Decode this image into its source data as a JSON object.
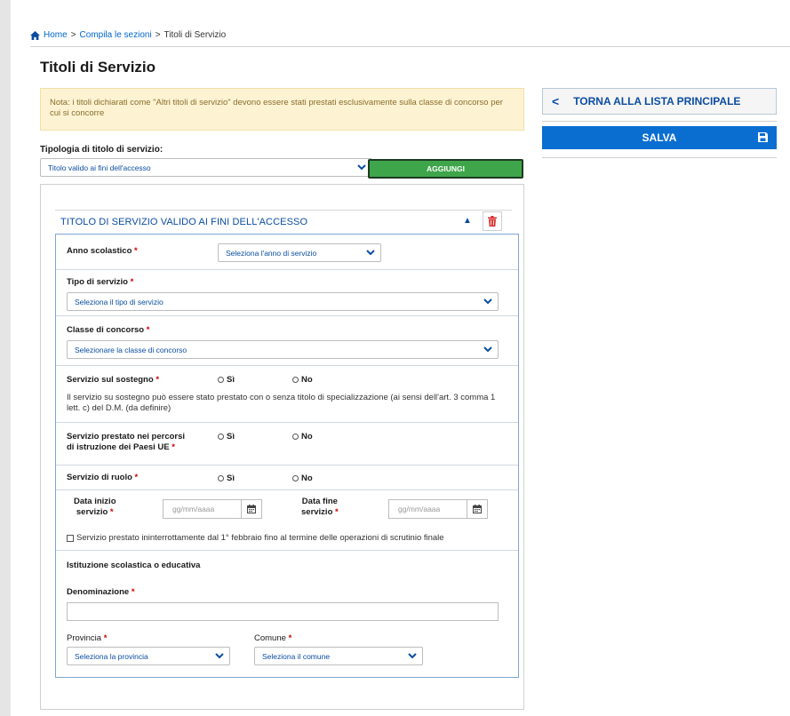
{
  "breadcrumb": {
    "home": "Home",
    "sep1": ">",
    "compila": "Compila le sezioni",
    "sep2": ">",
    "current": "Titoli di Servizio"
  },
  "page_title": "Titoli di Servizio",
  "note": "Nota: i titoli dichiarati come \"Altri titoli di servizio\" devono essere stati prestati esclusivamente sulla classe di concorso per cui si concorre",
  "tipologia": {
    "label": "Tipologia di titolo di servizio:",
    "selected": "Titolo valido ai fini dell'accesso",
    "add_label": "AGGIUNGI"
  },
  "side": {
    "back_chevron": "<",
    "back_label": "TORNA ALLA LISTA PRINCIPALE",
    "save_label": "SALVA"
  },
  "card": {
    "title": "TITOLO DI SERVIZIO VALIDO AI FINI DELL'ACCESSO",
    "collapse_glyph": "▲",
    "required_mark": "*",
    "anno": {
      "label": "Anno scolastico",
      "placeholder": "Seleziona l'anno di servizio"
    },
    "tipo": {
      "label": "Tipo di servizio",
      "placeholder": "Seleziona il tipo di servizio"
    },
    "classe": {
      "label": "Classe di concorso",
      "placeholder": "Selezionare la classe di concorso"
    },
    "sostegno": {
      "label": "Servizio sul sostegno",
      "yes": "Sì",
      "no": "No",
      "hint": "Il servizio su sostegno può essere stato prestato con o senza titolo di specializzazione (ai sensi dell'art. 3 comma 1 lett. c) del D.M. (da definire)"
    },
    "ue": {
      "label_line1": "Servizio prestato nei percorsi",
      "label_line2": "di istruzione dei Paesi UE",
      "yes": "Sì",
      "no": "No"
    },
    "ruolo": {
      "label": "Servizio di ruolo",
      "yes": "Sì",
      "no": "No"
    },
    "date": {
      "start_line1": "Data inizio",
      "start_line2": "servizio",
      "end_line1": "Data fine",
      "end_line2": "servizio",
      "placeholder": "gg/mm/aaaa",
      "continuous": "Servizio prestato ininterrottamente dal 1° febbraio fino al termine delle operazioni di scrutinio finale"
    },
    "istituzione": {
      "heading": "Istituzione scolastica o educativa",
      "denominazione_label": "Denominazione",
      "denominazione_value": "",
      "provincia_label": "Provincia",
      "provincia_placeholder": "Seleziona la provincia",
      "comune_label": "Comune",
      "comune_placeholder": "Seleziona il comune"
    }
  },
  "colors": {
    "link_blue": "#0b4da2",
    "primary_blue": "#0a6ed1",
    "add_green": "#3ea54a",
    "required_red": "#d10000",
    "trash_red": "#d9302c",
    "note_bg": "#fdf3d3"
  }
}
